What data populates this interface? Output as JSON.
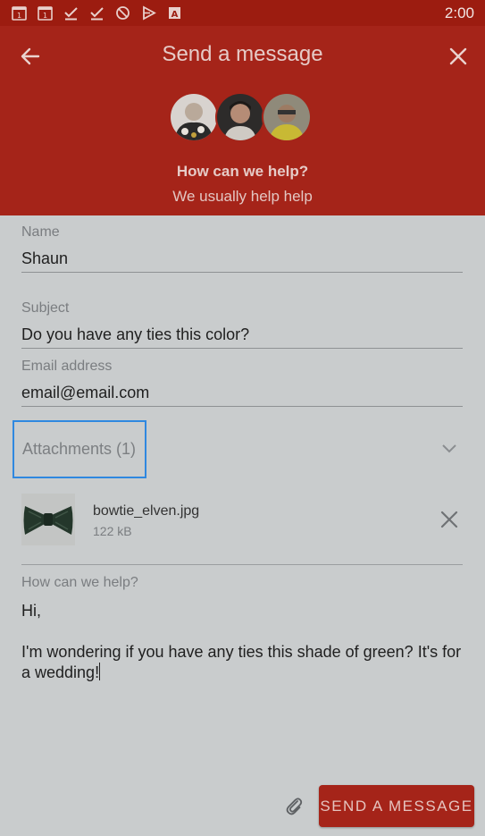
{
  "status_bar": {
    "time": "2:00",
    "icons": [
      "calendar-1-icon",
      "calendar-1-icon",
      "check-icon",
      "check-icon",
      "rotate-icon",
      "play-icon",
      "a-icon"
    ]
  },
  "header": {
    "title": "Send a message",
    "help_title": "How can we help?",
    "help_subtitle": "We usually help help",
    "accent_color": "#a52419"
  },
  "form": {
    "name": {
      "label": "Name",
      "value": "Shaun"
    },
    "subject": {
      "label": "Subject",
      "value": "Do you have any ties this color?"
    },
    "email": {
      "label": "Email address",
      "value": "email@email.com"
    },
    "attachments": {
      "label": "Attachments (1)",
      "files": [
        {
          "name": "bowtie_elven.jpg",
          "size": "122 kB"
        }
      ]
    },
    "message": {
      "label": "How can we help?",
      "value": "Hi,\n\nI'm wondering if you have any ties this shade of green? It's for a wedding!"
    }
  },
  "footer": {
    "send_label": "SEND A MESSAGE"
  }
}
